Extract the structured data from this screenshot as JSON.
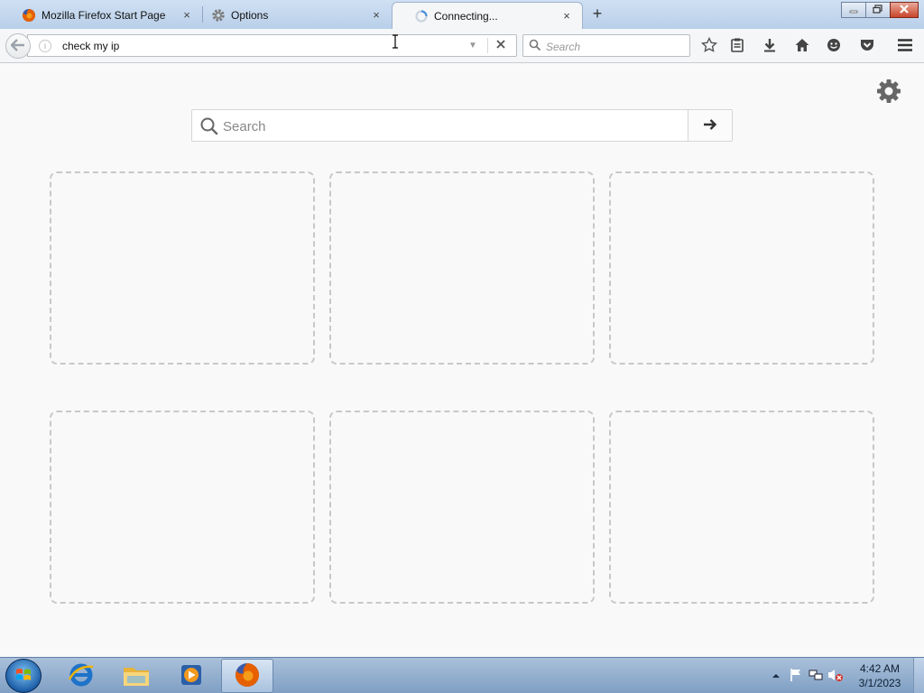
{
  "tabs": [
    {
      "label": "Mozilla Firefox Start Page",
      "icon": "firefox-icon",
      "active": false
    },
    {
      "label": "Options",
      "icon": "gear-icon",
      "active": false
    },
    {
      "label": "Connecting...",
      "icon": "loading-spinner-icon",
      "active": true
    }
  ],
  "tab_close_glyph": "×",
  "new_tab_glyph": "+",
  "window_controls": {
    "minimize": "minimize-icon",
    "maximize": "restore-icon",
    "close": "close-icon"
  },
  "urlbar": {
    "value": "check my ip",
    "info_glyph": "i"
  },
  "searchbar": {
    "placeholder": "Search"
  },
  "toolbar_icons": [
    "bookmark-star-icon",
    "reading-list-icon",
    "download-icon",
    "home-icon",
    "hello-icon",
    "pocket-icon",
    "menu-icon"
  ],
  "newtab": {
    "search_placeholder": "Search",
    "tile_count": 6
  },
  "taskbar": {
    "items": [
      "internet-explorer-icon",
      "windows-explorer-icon",
      "media-player-icon",
      "firefox-icon"
    ],
    "clock": {
      "time": "4:42 AM",
      "date": "3/1/2023"
    }
  },
  "colors": {
    "accent": "#0a84ff",
    "tile_border": "#c8c8c8",
    "taskbar": "#7f9fc4"
  }
}
